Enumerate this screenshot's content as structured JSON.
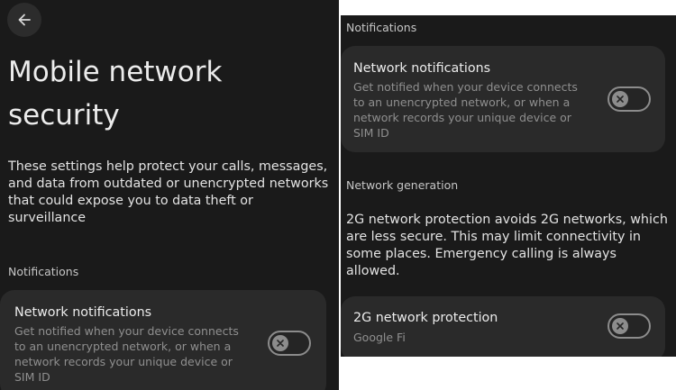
{
  "left": {
    "title": "Mobile network security",
    "description": "These settings help protect your calls, messages, and data from outdated or unencrypted networks that could expose you to data theft or surveillance",
    "notifications_header": "Notifications",
    "network_notifications": {
      "title": "Network notifications",
      "subtitle": "Get notified when your device connects to an unencrypted network, or when a network records your unique device or SIM ID",
      "enabled": false
    }
  },
  "right": {
    "notifications_header": "Notifications",
    "network_notifications": {
      "title": "Network notifications",
      "subtitle": "Get notified when your device connects to an unencrypted network, or when a network records your unique device or SIM ID",
      "enabled": false
    },
    "network_generation_header": "Network generation",
    "generation_description": "2G network protection avoids 2G networks, which are less secure. This may limit connectivity in some places. Emergency calling is always allowed.",
    "protection": {
      "title": "2G network protection",
      "subtitle": "Google Fi",
      "enabled": false
    }
  },
  "icons": {
    "back": "arrow-left-icon",
    "toggle_off": "close-icon"
  },
  "colors": {
    "background": "#1a1a1a",
    "card": "#2a2a2a",
    "text_primary": "#ececec",
    "text_secondary": "#8f8f8f",
    "toggle_outline": "#8c8c8c"
  }
}
